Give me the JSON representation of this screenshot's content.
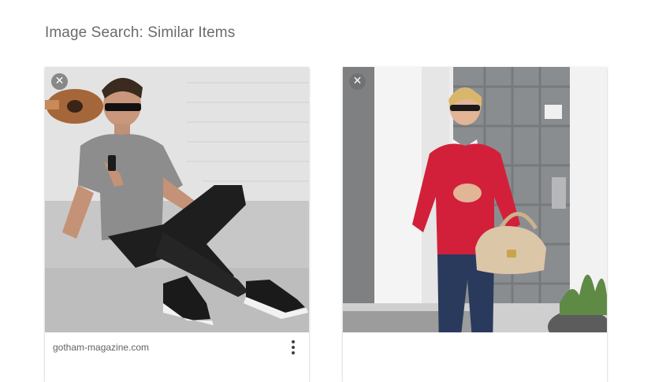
{
  "page": {
    "title": "Image Search: Similar Items"
  },
  "cards": [
    {
      "source": "gotham-magazine.com",
      "dismiss_icon": "close-icon",
      "menu_icon": "more-vert-icon"
    },
    {
      "source": "",
      "dismiss_icon": "close-icon",
      "menu_icon": "more-vert-icon"
    }
  ],
  "colors": {
    "title_text": "#6b6b6b",
    "card_shadow": "#d0d0d0",
    "sweater_red": "#d2203a",
    "jeans_blue": "#2a3a5c",
    "bag_beige": "#dcc6a8",
    "door_grey": "#8a8d90"
  }
}
